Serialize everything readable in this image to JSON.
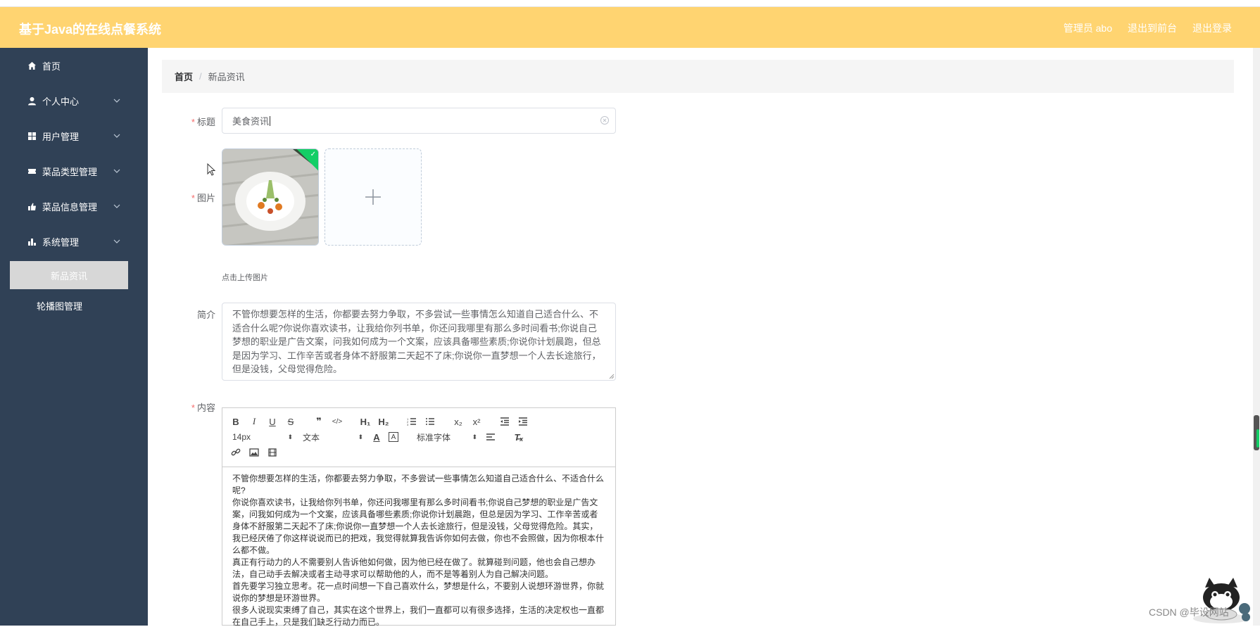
{
  "header": {
    "app_title": "基于Java的在线点餐系统",
    "admin_label": "管理员 abo",
    "front_link": "退出到前台",
    "logout_link": "退出登录"
  },
  "sidebar": {
    "items": [
      {
        "label": "首页",
        "icon": "home-icon"
      },
      {
        "label": "个人中心",
        "icon": "user-icon"
      },
      {
        "label": "用户管理",
        "icon": "grid-icon"
      },
      {
        "label": "菜品类型管理",
        "icon": "ticket-icon"
      },
      {
        "label": "菜品信息管理",
        "icon": "thumb-icon"
      },
      {
        "label": "系统管理",
        "icon": "chart-icon"
      }
    ],
    "sub_items": [
      {
        "label": "新品资讯",
        "active": true
      },
      {
        "label": "轮播图管理",
        "active": false
      }
    ]
  },
  "breadcrumb": {
    "home": "首页",
    "separator": "/",
    "current": "新品资讯"
  },
  "form": {
    "title_label": "标题",
    "title_value": "美食资讯",
    "image_label": "图片",
    "upload_tip": "点击上传图片",
    "desc_label": "简介",
    "desc_value": "不管你想要怎样的生活，你都要去努力争取，不多尝试一些事情怎么知道自己适合什么、不适合什么呢?你说你喜欢读书，让我给你列书单，你还问我哪里有那么多时间看书;你说自己梦想的职业是广告文案，问我如何成为一个文案，应该具备哪些素质;你说你计划晨跑，但总是因为学习、工作辛苦或者身体不舒服第二天起不了床;你说你一直梦想一个人去长途旅行，但是没钱，父母觉得危险。",
    "content_label": "内容"
  },
  "editor": {
    "font_size": "14px",
    "block_format": "文本",
    "font_family": "标准字体",
    "paragraphs": [
      "不管你想要怎样的生活，你都要去努力争取，不多尝试一些事情怎么知道自己适合什么、不适合什么呢?",
      "你说你喜欢读书，让我给你列书单，你还问我哪里有那么多时间看书;你说自己梦想的职业是广告文案，问我如何成为一个文案，应该具备哪些素质;你说你计划晨跑，但总是因为学习、工作辛苦或者身体不舒服第二天起不了床;你说你一直梦想一个人去长途旅行，但是没钱，父母觉得危险。其实，我已经厌倦了你这样说说而已的把戏，我觉得就算我告诉你如何去做，你也不会照做，因为你根本什么都不做。",
      "真正有行动力的人不需要别人告诉他如何做，因为他已经在做了。就算碰到问题，他也会自己想办法，自己动手去解决或者主动寻求可以帮助他的人，而不是等着别人为自己解决问题。",
      "首先要学习独立思考。花一点时间想一下自己喜欢什么，梦想是什么，不要别人说想环游世界，你就说你的梦想是环游世界。",
      "很多人说现实束缚了自己，其实在这个世界上，我们一直都可以有很多选择，生活的决定权也一直都在自己手上，只是我们缺乏行动力而已。"
    ]
  },
  "watermark": "CSDN @毕设网站"
}
